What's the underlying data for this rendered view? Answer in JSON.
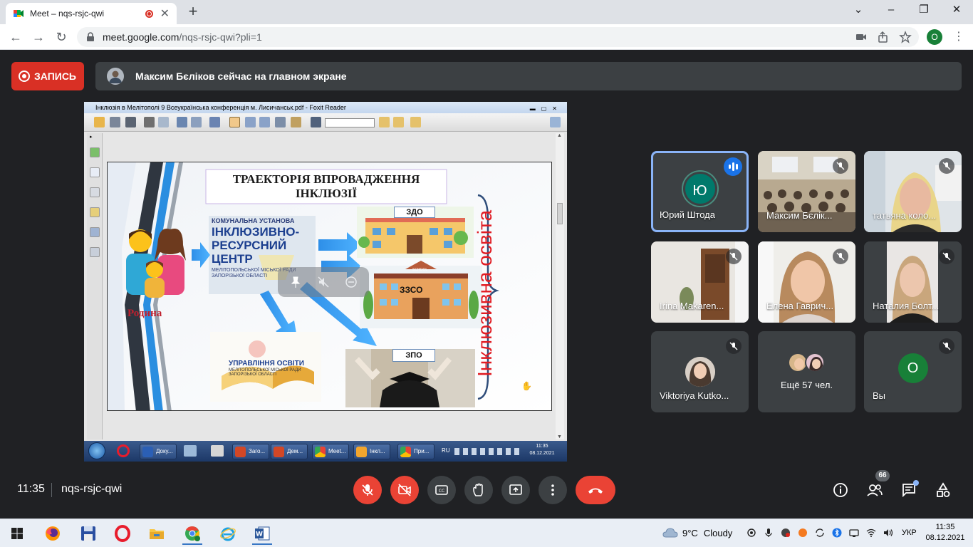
{
  "browser": {
    "tab_title": "Meet – nqs-rsjc-qwi",
    "url_host": "meet.google.com",
    "url_path": "/nqs-rsjc-qwi?pli=1",
    "profile_initial": "О"
  },
  "meet": {
    "record_label": "ЗАПИСЬ",
    "pinned_text": "Максим Бєліков сейчас на главном экране",
    "time": "11:35",
    "meeting_code": "nqs-rsjc-qwi",
    "participants_badge": "66"
  },
  "presentation": {
    "window_title": "Інклюзія в Мелітополі 9 Всеукраїнська конференція м. Лисичанськ.pdf - Foxit Reader",
    "slide_title_line1": "ТРАЕКТОРІЯ ВПРОВАДЖЕННЯ",
    "slide_title_line2": "ІНКЛЮЗІЇ",
    "family_label": "Родина",
    "center_l1": "КОМУНАЛЬНА УСТАНОВА",
    "center_l2": "ІНКЛЮЗИВНО-",
    "center_l3": "РЕСУРСНИЙ",
    "center_l4": "ЦЕНТР",
    "center_l5": "МЕЛІТОПОЛЬСЬКОЇ МІСЬКОЇ РАДИ",
    "center_l6": "ЗАПОРІЗЬКОЇ ОБЛАСТІ",
    "zdo": "ЗДО",
    "zzso": "ЗЗСО",
    "zpo": "ЗПО",
    "school_sign": "SCHOOL",
    "upr_title": "УПРАВЛІННЯ ОСВІТИ",
    "upr_sub1": "МЕЛІТОПОЛЬСЬКОЇ МІСЬКОЇ РАДИ",
    "upr_sub2": "ЗАПОРІЗЬКОЇ ОБЛАСТІ",
    "vertical_text": "Інклюзивна освіта",
    "inner_taskbar": {
      "items": [
        "Доку...",
        "Заго...",
        "Дем...",
        "Meet...",
        "Інкл...",
        "При..."
      ],
      "lang": "RU",
      "time": "11:35",
      "date": "08.12.2021"
    }
  },
  "tiles": [
    {
      "name": "Юрий Штода",
      "initial": "Ю"
    },
    {
      "name": "Максим Бєлік..."
    },
    {
      "name": "татьяна коло..."
    },
    {
      "name": "Irina Makaren..."
    },
    {
      "name": "Елена Гаврич..."
    },
    {
      "name": "Наталия Болт..."
    },
    {
      "name": "Viktoriya Kutko..."
    },
    {
      "name": "Ещё 57 чел."
    },
    {
      "name": "Вы",
      "initial": "О"
    }
  ],
  "os_taskbar": {
    "weather_temp": "9°C",
    "weather_text": "Cloudy",
    "lang": "УКР",
    "time": "11:35",
    "date": "08.12.2021"
  },
  "colors": {
    "meet_bg": "#202124",
    "tile_bg": "#3c4043",
    "danger": "#ea4335",
    "speaking_border": "#8ab4f8",
    "avatar_teal": "#00796b",
    "avatar_green": "#188038"
  }
}
